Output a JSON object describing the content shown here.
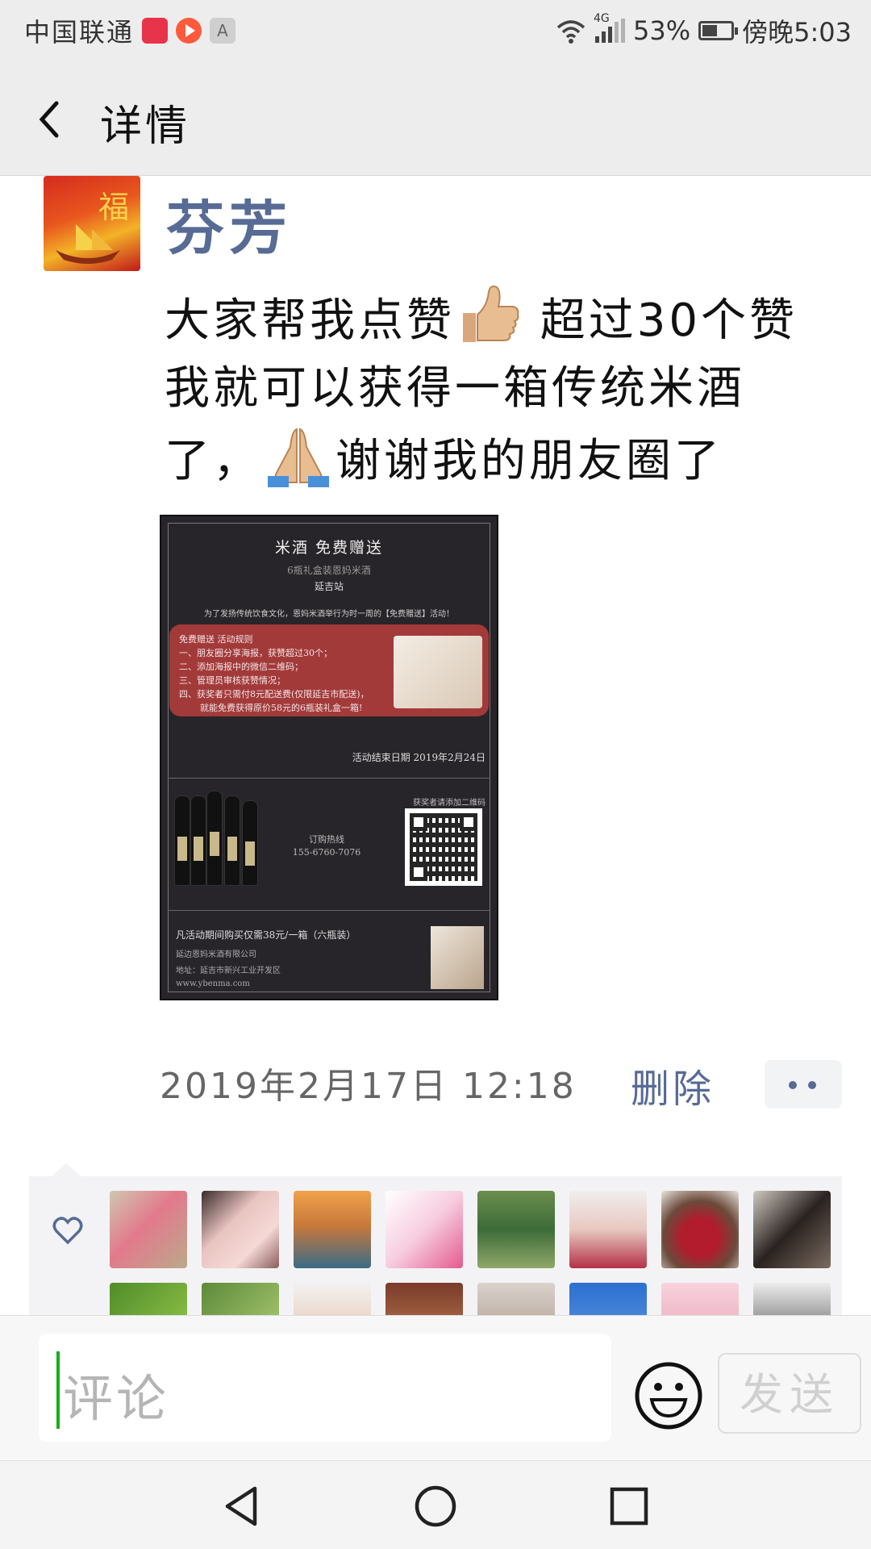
{
  "status_bar": {
    "carrier": "中国联通",
    "network": "4G",
    "battery": "53%",
    "battery_level": 0.53,
    "time": "傍晚5:03",
    "icons": [
      "red-app-icon",
      "video-app-icon",
      "a-app-icon",
      "wifi-icon",
      "signal-icon",
      "battery-icon"
    ]
  },
  "header": {
    "back_icon": "chevron-left-icon",
    "title": "详情"
  },
  "post": {
    "author": "芬芳",
    "avatar_text": "福",
    "text_part1": "大家帮我点赞",
    "text_part2": " 超过30个赞我就可以获得一箱传统米酒了，",
    "text_part3": "谢谢我的朋友圈了",
    "emojis": [
      "thumbs-up-emoji",
      "folded-hands-emoji"
    ],
    "timestamp": "2019年2月17日  12:18",
    "delete_label": "删除"
  },
  "poster": {
    "title": "米酒 免费赠送",
    "subtitle": "6瓶礼盒装恩妈米酒",
    "station": "延吉站",
    "intro": "为了发扬传统饮食文化，恩妈米酒举行为时一周的【免费赠送】活动！",
    "rules": [
      "免费赠送 活动规则",
      "一、朋友圈分享海报，获赞超过30个；",
      "二、添加海报中的微信二维码；",
      "三、管理员审核获赞情况；",
      "四、获奖者只需付8元配送费(仅限延吉市配送)，",
      "就能免费获得原价58元的6瓶装礼盒一箱!"
    ],
    "end_date": "活动结束日期 2019年2月24日",
    "hotline_label": "订购热线",
    "hotline": "155-6760-7076",
    "qr_label": "获奖者请添加二维码",
    "footer_offer": "凡活动期间购买仅需38元/一箱（六瓶装）",
    "company": "延边恩妈米酒有限公司",
    "address": "地址：延吉市新兴工业开发区",
    "website": "www.ybenma.com"
  },
  "likes": {
    "heart_icon": "heart-outline-icon",
    "avatar_count_visible": 16
  },
  "comment_bar": {
    "placeholder": "评论",
    "emoji_icon": "smiley-icon",
    "send_label": "发送"
  },
  "nav_bar": {
    "icons": [
      "back-triangle-icon",
      "home-circle-icon",
      "recents-square-icon"
    ]
  },
  "colors": {
    "link_blue": "#576b95",
    "background": "#ededed",
    "caret_green": "#1aad19"
  }
}
